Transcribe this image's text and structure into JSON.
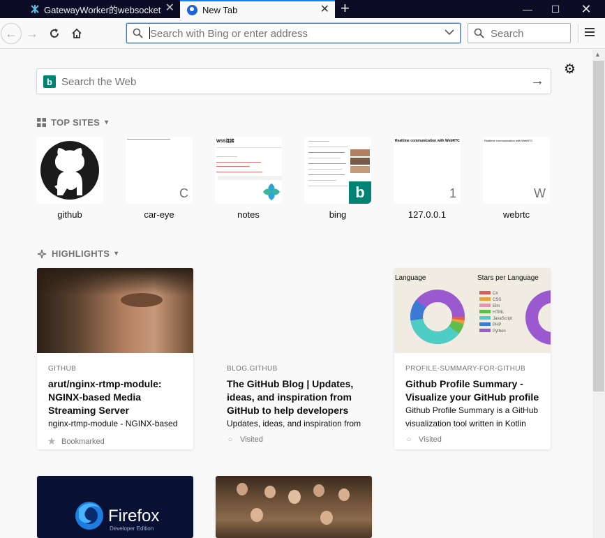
{
  "tabs": [
    {
      "label": "GatewayWorker的websocket",
      "active": false
    },
    {
      "label": "New Tab",
      "active": true
    }
  ],
  "nav": {
    "url_placeholder": "Search with Bing or enter address",
    "search_placeholder": "Search"
  },
  "websearch": {
    "placeholder": "Search the Web",
    "engine_icon": "bing-icon"
  },
  "top_sites": {
    "title": "TOP SITES",
    "items": [
      {
        "name": "github",
        "icon": "github-icon"
      },
      {
        "name": "car-eye",
        "letter": "C"
      },
      {
        "name": "notes",
        "letter": ""
      },
      {
        "name": "bing",
        "letter": ""
      },
      {
        "name": "127.0.0.1",
        "letter": "1"
      },
      {
        "name": "webrtc",
        "letter": "W"
      }
    ],
    "thumb_texts": {
      "notes_heading": "WSS连接",
      "r127_heading": "Realtime communication with WebRTC",
      "webrtc_heading": "Realtime communication with WebRTC"
    }
  },
  "highlights": {
    "title": "HIGHLIGHTS",
    "cards": [
      {
        "source": "GITHUB",
        "title": "arut/nginx-rtmp-module: NGINX-based Media Streaming Server",
        "description": "nginx-rtmp-module - NGINX-based",
        "context": "Bookmarked"
      },
      {
        "source": "BLOG.GITHUB",
        "title": "The GitHub Blog | Updates, ideas, and inspiration from GitHub to help developers",
        "description": "Updates, ideas, and inspiration from",
        "context": "Visited"
      },
      {
        "source": "PROFILE-SUMMARY-FOR-GITHUB",
        "title": "Github Profile Summary - Visualize your GitHub profile",
        "description": "Github Profile Summary is a GitHub visualization tool written in Kotlin",
        "context": "Visited",
        "image_labels": {
          "left": "Language",
          "right": "Stars per Language"
        },
        "legend": [
          "C#",
          "CSS",
          "Elm",
          "HTML",
          "JavaScript",
          "PHP",
          "Python"
        ]
      },
      {
        "brand": "Firefox",
        "brand_sub": "Developer Edition"
      },
      {}
    ]
  },
  "colors": {
    "accent": "#0a84ff",
    "tabbar": "#0c0c26",
    "bing": "#008373"
  }
}
